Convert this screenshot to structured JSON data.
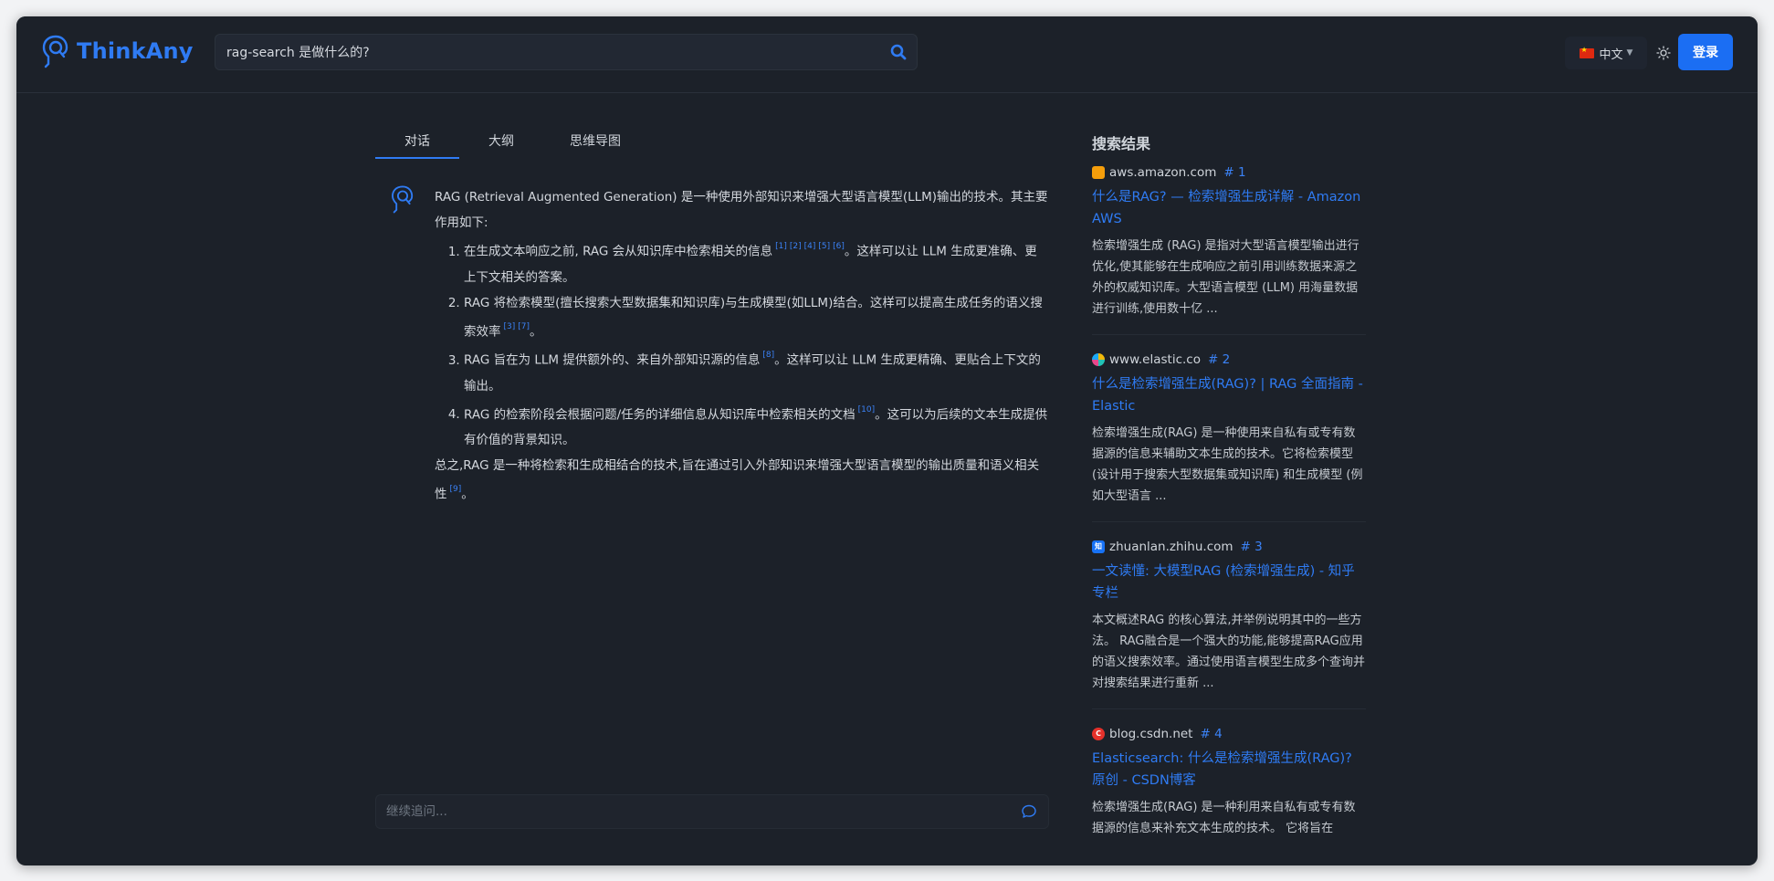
{
  "header": {
    "logo_text": "ThinkAny",
    "search_value": "rag-search 是做什么的?",
    "lang_label": "中文",
    "login_label": "登录"
  },
  "tabs": [
    {
      "label": "对话",
      "active": true
    },
    {
      "label": "大纲",
      "active": false
    },
    {
      "label": "思维导图",
      "active": false
    }
  ],
  "answer": {
    "intro": "RAG (Retrieval Augmented Generation) 是一种使用外部知识来增强大型语言模型(LLM)输出的技术。其主要作用如下:",
    "items": [
      {
        "text": "在生成文本响应之前, RAG 会从知识库中检索相关的信息",
        "refs": [
          "[1]",
          "[2]",
          "[4]",
          "[5]",
          "[6]"
        ],
        "tail": "。这样可以让 LLM 生成更准确、更上下文相关的答案。"
      },
      {
        "text": "RAG 将检索模型(擅长搜索大型数据集和知识库)与生成模型(如LLM)结合。这样可以提高生成任务的语义搜索效率",
        "refs": [
          "[3]",
          "[7]"
        ],
        "tail": "。"
      },
      {
        "text": "RAG 旨在为 LLM 提供额外的、来自外部知识源的信息",
        "refs": [
          "[8]"
        ],
        "tail": "。这样可以让 LLM 生成更精确、更贴合上下文的输出。"
      },
      {
        "text": "RAG 的检索阶段会根据问题/任务的详细信息从知识库中检索相关的文档",
        "refs": [
          "[10]"
        ],
        "tail": "。这可以为后续的文本生成提供有价值的背景知识。"
      }
    ],
    "summary": {
      "text": "总之,RAG 是一种将检索和生成相结合的技术,旨在通过引入外部知识来增强大型语言模型的输出质量和语义相关性",
      "refs": [
        "[9]"
      ],
      "tail": "。"
    }
  },
  "followup": {
    "placeholder": "继续追问..."
  },
  "results": {
    "title": "搜索结果",
    "items": [
      {
        "domain": "aws.amazon.com",
        "num": "# 1",
        "icon_color": "#f59e0b",
        "title": "什么是RAG? — 检索增强生成详解 - Amazon AWS",
        "snippet": "检索增强生成 (RAG) 是指对大型语言模型输出进行优化,使其能够在生成响应之前引用训练数据来源之外的权威知识库。大型语言模型 (LLM) 用海量数据进行训练,使用数十亿 ..."
      },
      {
        "domain": "www.elastic.co",
        "num": "# 2",
        "icon_color": "#22c3b5",
        "title": "什么是检索增强生成(RAG)? | RAG 全面指南 - Elastic",
        "snippet": "检索增强生成(RAG) 是一种使用来自私有或专有数据源的信息来辅助文本生成的技术。它将检索模型 (设计用于搜索大型数据集或知识库) 和生成模型 (例如大型语言 ..."
      },
      {
        "domain": "zhuanlan.zhihu.com",
        "num": "# 3",
        "icon_color": "#1772f6",
        "icon_text": "知",
        "title": "一文读懂: 大模型RAG (检索增强生成) - 知乎专栏",
        "snippet": "本文概述RAG 的核心算法,并举例说明其中的一些方法。 RAG融合是一个强大的功能,能够提高RAG应用的语义搜索效率。通过使用语言模型生成多个查询并对搜索结果进行重新 ..."
      },
      {
        "domain": "blog.csdn.net",
        "num": "# 4",
        "icon_color": "#e5312b",
        "icon_text": "C",
        "title": "Elasticsearch: 什么是检索增强生成(RAG)? 原创 - CSDN博客",
        "snippet": "检索增强生成(RAG) 是一种利用来自私有或专有数据源的信息来补充文本生成的技术。 它将旨在"
      }
    ]
  }
}
